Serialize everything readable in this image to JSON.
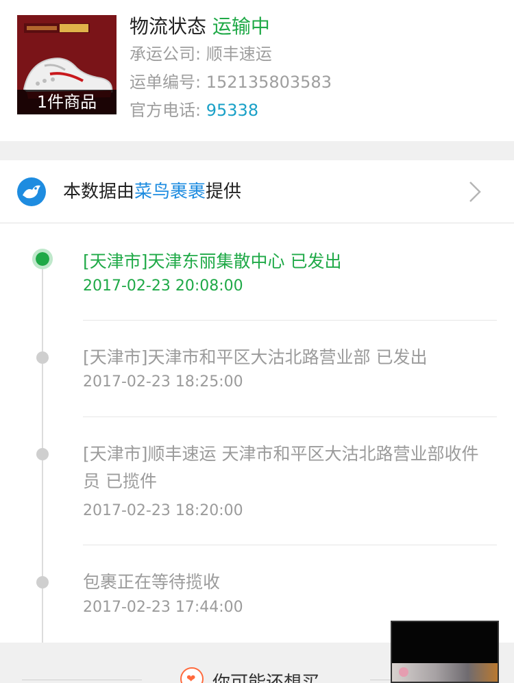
{
  "header": {
    "thumbnail_count": "1件商品",
    "status_label": "物流状态",
    "status_value": "运输中",
    "carrier_label": "承运公司:",
    "carrier_value": "顺丰速运",
    "waybill_label": "运单编号:",
    "waybill_value": "152135803583",
    "phone_label": "官方电话:",
    "phone_value": "95338"
  },
  "provider": {
    "prefix": "本数据由",
    "brand": "菜鸟裹裹",
    "suffix": "提供"
  },
  "timeline": [
    {
      "text": "[天津市]天津东丽集散中心 已发出",
      "time": "2017-02-23 20:08:00",
      "active": true
    },
    {
      "text": "[天津市]天津市和平区大沽北路营业部 已发出",
      "time": "2017-02-23 18:25:00",
      "active": false
    },
    {
      "text": "[天津市]顺丰速运 天津市和平区大沽北路营业部收件员 已揽件",
      "time": "2017-02-23 18:20:00",
      "active": false
    },
    {
      "text": "包裹正在等待揽收",
      "time": "2017-02-23 17:44:00",
      "active": false
    }
  ],
  "recommend": {
    "title": "你可能还想买"
  },
  "colors": {
    "accent_green": "#1fa947",
    "link_blue": "#1e8ce0",
    "phone_teal": "#1aa0c7",
    "heart_orange": "#ff6a3d"
  }
}
